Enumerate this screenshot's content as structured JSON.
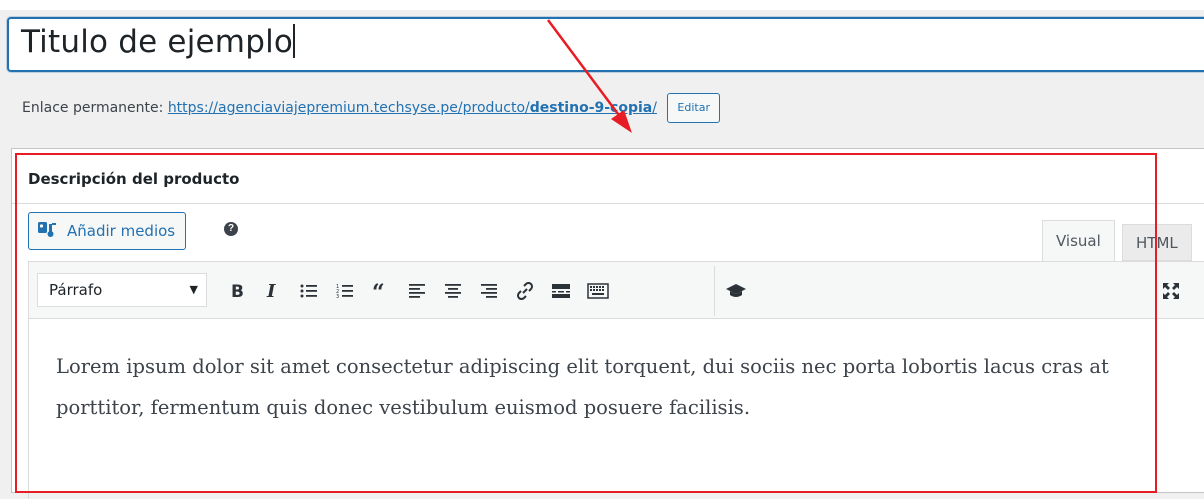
{
  "title_field": {
    "value": "Titulo de ejemplo"
  },
  "permalink": {
    "label": "Enlace permanente:",
    "url_base": "https://agenciaviajepremium.techsyse.pe/producto/",
    "slug": "destino-9-copia",
    "trailing": "/",
    "edit_label": "Editar"
  },
  "metabox": {
    "title": "Descripción del producto",
    "add_media_label": "Añadir medios",
    "help_icon": "question-circle-icon",
    "tabs": [
      {
        "label": "Visual",
        "active": true
      },
      {
        "label": "HTML",
        "active": false
      }
    ],
    "format_select": "Párrafo",
    "toolbar_icons": [
      "bold-icon",
      "italic-icon",
      "bullet-list-icon",
      "numbered-list-icon",
      "blockquote-icon",
      "align-left-icon",
      "align-center-icon",
      "align-right-icon",
      "link-icon",
      "read-more-icon",
      "toolbar-toggle-icon",
      "graduation-cap-icon",
      "fullscreen-icon"
    ],
    "content": "Lorem ipsum dolor sit amet consectetur adipiscing elit torquent, dui sociis nec porta lobortis lacus cras at porttitor, fermentum quis donec vestibulum euismod posuere facilisis."
  },
  "colors": {
    "accent": "#2271b1",
    "annotation_red": "#e81c24",
    "background": "#f0f0f1"
  }
}
